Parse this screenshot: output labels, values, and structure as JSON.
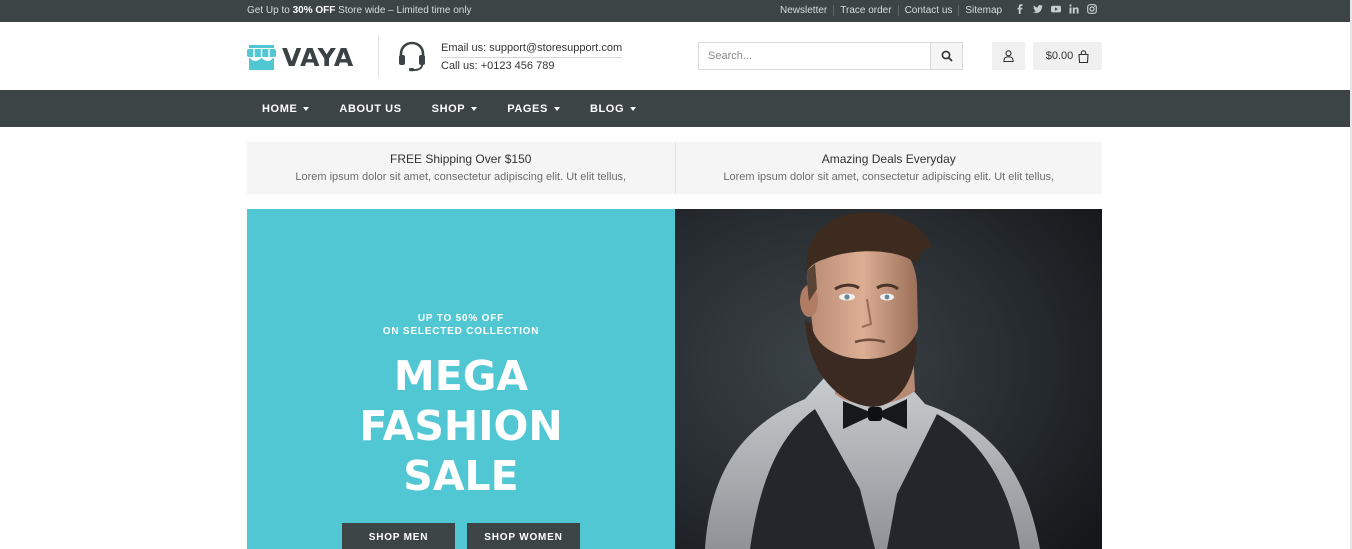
{
  "topbar": {
    "promo_prefix": "Get Up to ",
    "promo_bold": "30% OFF",
    "promo_suffix": " Store wide – Limited time only",
    "links": [
      "Newsletter",
      "Trace order",
      "Contact us",
      "Sitemap"
    ],
    "social_icons": [
      "facebook-icon",
      "twitter-icon",
      "youtube-icon",
      "linkedin-icon",
      "instagram-icon"
    ]
  },
  "header": {
    "logo_text": "VAYA",
    "email_line": "Email us: support@storesupport.com",
    "phone_line": "Call us: +0123 456 789",
    "search_placeholder": "Search...",
    "cart_total": "$0.00"
  },
  "nav": {
    "items": [
      {
        "label": "HOME",
        "dropdown": true
      },
      {
        "label": "ABOUT US",
        "dropdown": false
      },
      {
        "label": "SHOP",
        "dropdown": true
      },
      {
        "label": "PAGES",
        "dropdown": true
      },
      {
        "label": "BLOG",
        "dropdown": true
      }
    ]
  },
  "features": [
    {
      "title": "FREE Shipping Over $150",
      "desc": "Lorem ipsum dolor sit amet, consectetur adipiscing elit. Ut elit tellus,"
    },
    {
      "title": "Amazing Deals Everyday",
      "desc": "Lorem ipsum dolor sit amet, consectetur adipiscing elit. Ut elit tellus,"
    }
  ],
  "banner": {
    "eyebrow_line1": "UP TO 50% OFF",
    "eyebrow_line2": "ON SELECTED COLLECTION",
    "headline_line1": "MEGA",
    "headline_line2": "FASHION",
    "headline_line3": "SALE",
    "btn_men": "SHOP MEN",
    "btn_women": "SHOP WOMEN"
  },
  "colors": {
    "dark": "#3c4446",
    "accent": "#52c7d4"
  }
}
